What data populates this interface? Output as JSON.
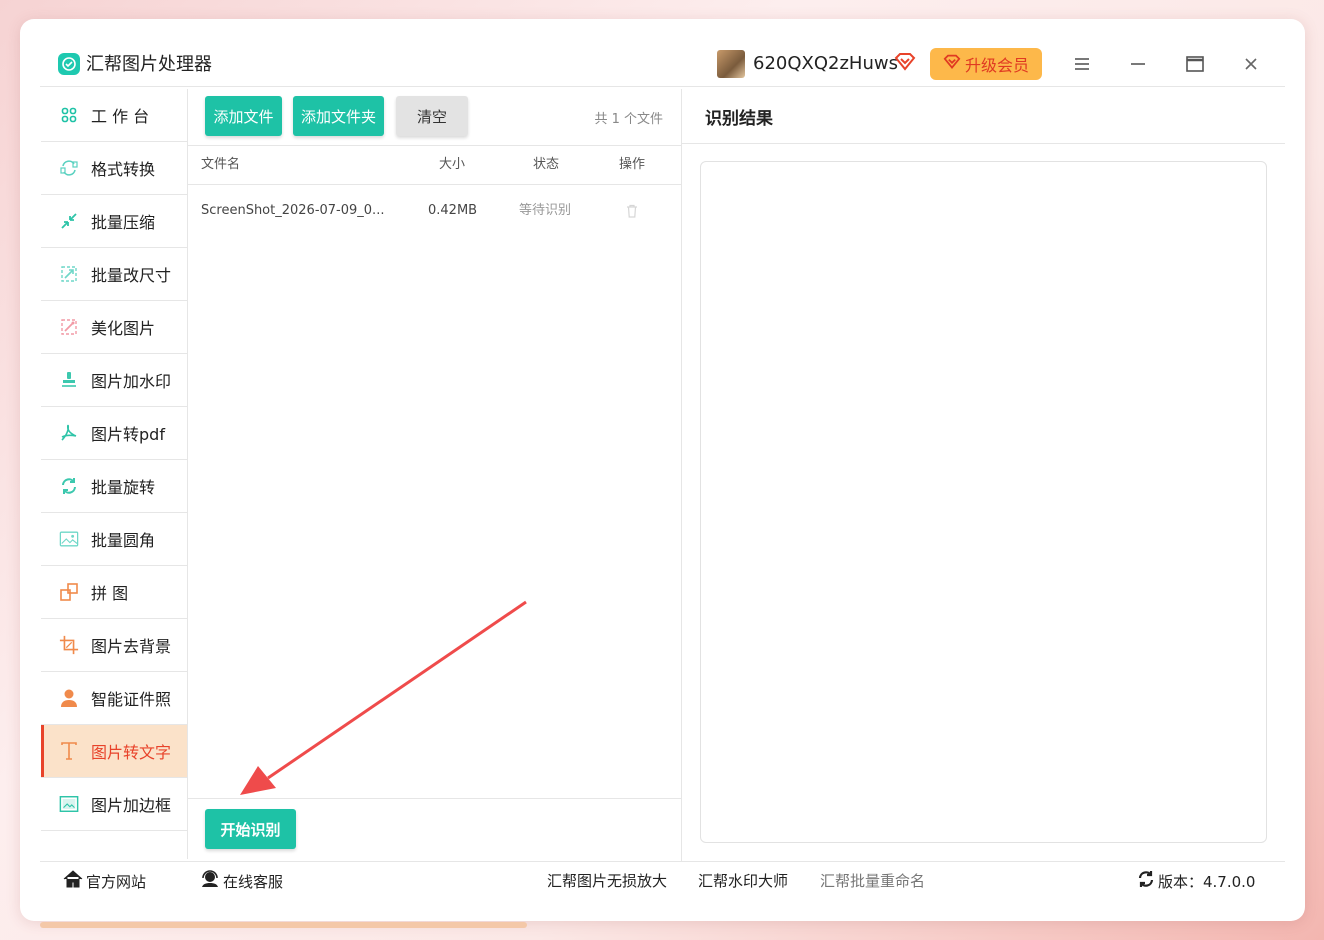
{
  "app": {
    "title": "汇帮图片处理器",
    "username": "620QXQ2zHuws",
    "upgrade_label": "升级会员"
  },
  "sidebar": {
    "items": [
      {
        "label": "工 作 台",
        "icon": "grid-icon"
      },
      {
        "label": "格式转换",
        "icon": "convert-icon"
      },
      {
        "label": "批量压缩",
        "icon": "compress-icon"
      },
      {
        "label": "批量改尺寸",
        "icon": "resize-icon"
      },
      {
        "label": "美化图片",
        "icon": "beautify-icon"
      },
      {
        "label": "图片加水印",
        "icon": "watermark-icon"
      },
      {
        "label": "图片转pdf",
        "icon": "pdf-icon"
      },
      {
        "label": "批量旋转",
        "icon": "rotate-icon"
      },
      {
        "label": "批量圆角",
        "icon": "round-corner-icon"
      },
      {
        "label": "拼    图",
        "icon": "collage-icon"
      },
      {
        "label": "图片去背景",
        "icon": "crop-icon"
      },
      {
        "label": "智能证件照",
        "icon": "person-icon"
      },
      {
        "label": "图片转文字",
        "icon": "text-icon",
        "active": true
      },
      {
        "label": "图片加边框",
        "icon": "frame-icon"
      }
    ]
  },
  "toolbar": {
    "add_file": "添加文件",
    "add_folder": "添加文件夹",
    "clear": "清空",
    "file_count": "共 1 个文件"
  },
  "table": {
    "headers": {
      "name": "文件名",
      "size": "大小",
      "status": "状态",
      "action": "操作"
    },
    "rows": [
      {
        "name": "ScreenShot_2026-07-09_0...",
        "size": "0.42MB",
        "status": "等待识别"
      }
    ]
  },
  "start_button": "开始识别",
  "result": {
    "title": "识别结果"
  },
  "footer": {
    "official_site": "官方网站",
    "online_service": "在线客服",
    "link1": "汇帮图片无损放大",
    "link2": "汇帮水印大师",
    "link3": "汇帮批量重命名",
    "version": "版本：4.7.0.0"
  },
  "colors": {
    "accent": "#1ec2a6",
    "active_text": "#e8432a",
    "active_bg": "#fbe2c9",
    "upgrade_bg": "#fdb84a",
    "annotation_arrow": "#ef4b4b"
  }
}
